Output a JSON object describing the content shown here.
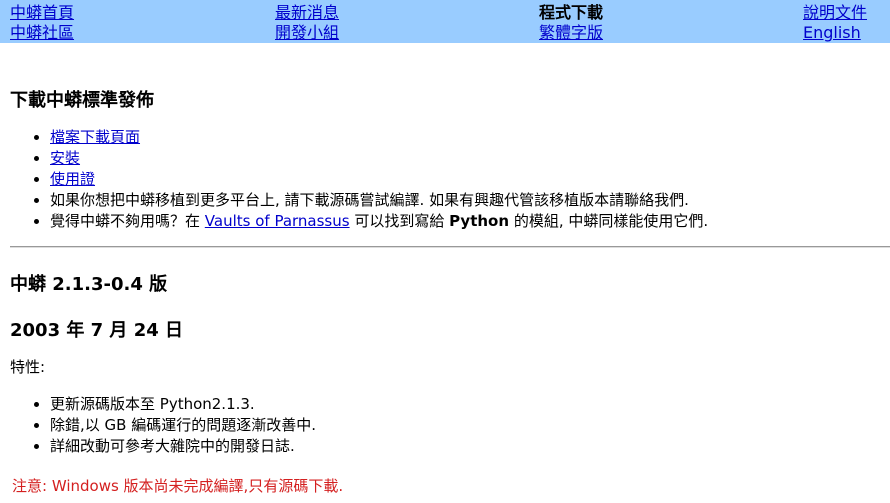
{
  "nav": {
    "row1": {
      "home": "中蟒首頁",
      "news": "最新消息",
      "download": "程式下載",
      "docs": "說明文件"
    },
    "row2": {
      "community": "中蟒社區",
      "devgroup": "開發小組",
      "traditional": "繁體字版",
      "english": "English"
    }
  },
  "section1": {
    "title": "下載中蟒標準發佈",
    "items": {
      "files": "檔案下載頁面",
      "install": "安裝",
      "license": "使用證"
    },
    "port_text": "如果你想把中蟒移植到更多平台上, 請下載源碼嘗試編譯. 如果有興趣代管該移植版本請聯絡我們.",
    "modules": {
      "prefix": "覺得中蟒不夠用嗎？在",
      "link": "Vaults of Parnassus",
      "middle": "可以找到寫給",
      "bold": "Python",
      "suffix": "的模組, 中蟒同樣能使用它們."
    }
  },
  "release": {
    "version": "中蟒 2.1.3-0.4 版",
    "date": "2003 年 7 月 24 日",
    "features_label": "特性:",
    "features": [
      "更新源碼版本至 Python2.1.3.",
      "除錯,以 GB 編碼運行的問題逐漸改善中.",
      "詳細改動可參考大雜院中的開發日誌."
    ],
    "note": "注意: Windows 版本尚未完成編譯,只有源碼下載."
  },
  "colors": {
    "nav_bg": "#99ccff",
    "link": "#0000cc",
    "note": "#d42020"
  }
}
